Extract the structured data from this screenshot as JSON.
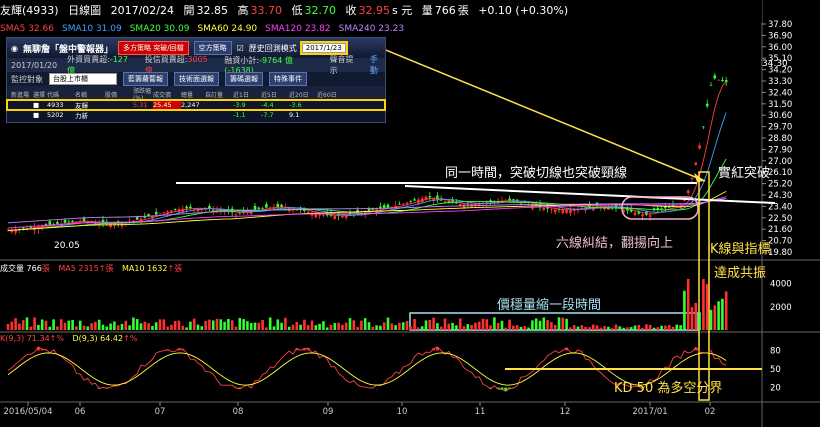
{
  "header": {
    "stock": "友輝(4933)",
    "period": "日線圖",
    "date": "2017/02/24",
    "open_label": "開",
    "open": "32.85",
    "high_label": "高",
    "high": "33.70",
    "low_label": "低",
    "low": "32.70",
    "close_label": "收",
    "close": "32.95",
    "close_suffix": "s 元",
    "vol_label": "量",
    "vol": "766",
    "vol_unit": "張",
    "change": "+0.10 (+0.30%)"
  },
  "ma_legend": [
    {
      "label": "SMA5 32.66",
      "color": "#ff4040"
    },
    {
      "label": "SMA10 31.09",
      "color": "#40a0ff"
    },
    {
      "label": "SMA20 30.09",
      "color": "#40ff40"
    },
    {
      "label": "SMA60 24.90",
      "color": "#ffff40"
    },
    {
      "label": "SMA120 23.82",
      "color": "#ff40ff"
    },
    {
      "label": "SMA240 23.23",
      "color": "#c080ff"
    }
  ],
  "panel": {
    "title": "無聊詹「盤中警報器」",
    "btn_multi": "多方策略 突破/回檔",
    "btn_empty": "空方策略",
    "history_label": "歷史回測模式",
    "date_value": "2017/1/23",
    "info_date": "2017/01/20",
    "info_foreign": "外資買賣超:",
    "info_foreign_val": "-127 億",
    "info_trust": "投信買賣超:",
    "info_trust_val": "3005 億",
    "info_small": "融資小計:",
    "info_small_val": "-9764 億 (-1638)",
    "sound": "聲音提示",
    "hand": "手動",
    "monitor_label": "監控對象",
    "monitor_value": "台股上市櫃",
    "tab1": "藍籌蘿蔔報",
    "tab2": "技術面選報",
    "tab3": "籌碼選報",
    "special": "特殊事件",
    "columns": [
      "新進場",
      "選擇",
      "代碼",
      "名稱",
      "股價",
      "漲跌幅(%)",
      "成交價",
      "總量",
      "自訂量",
      "近1日",
      "近5日",
      "近20日",
      "近60日"
    ],
    "rows": [
      [
        "",
        "■",
        "4933",
        "友輝",
        "",
        "5.31",
        "25.45",
        "2,247",
        "",
        "-3.9",
        "-4.4",
        "-3.6",
        ""
      ],
      [
        "",
        "■",
        "5202",
        "力新",
        "",
        "",
        "",
        "",
        "",
        "-1.1",
        "-7.7",
        "9.1",
        ""
      ]
    ]
  },
  "annotations": {
    "a1": "同一時間，突破切線也突破頸線",
    "a2": "實紅突破",
    "a3": "六線糾結，翻揚向上",
    "a4": "價穩量縮一段時間",
    "a5": "K線與指標",
    "a6": "達成共振",
    "a7": "KD 50 為多空分界"
  },
  "volume_legend": {
    "vol": "成交量 766",
    "ma5": "MA5 2315",
    "ma10": "MA10 1632"
  },
  "kd_legend": {
    "k": "K(9,3) 71.34",
    "d": "D(9,3) 64.42"
  },
  "chart_data": {
    "type": "candlestick",
    "x_ticks": [
      "2016/05/04",
      "06",
      "07",
      "08",
      "09",
      "10",
      "11",
      "12",
      "2017/01",
      "02"
    ],
    "price_axis": [
      "37.80",
      "36.90",
      "36.00",
      "35.10",
      "34.20",
      "33.30",
      "32.40",
      "31.50",
      "30.60",
      "29.70",
      "28.80",
      "27.90",
      "27.00",
      "26.10",
      "25.20",
      "24.30",
      "23.40",
      "22.50",
      "21.60",
      "20.70",
      "19.80"
    ],
    "ylim": [
      19.8,
      37.8
    ],
    "low_label": "20.05",
    "high_label": "34.30",
    "volume_axis": [
      "4000",
      "2000"
    ],
    "kd_axis": [
      "80",
      "50",
      "20"
    ],
    "neckline": 25.0
  }
}
